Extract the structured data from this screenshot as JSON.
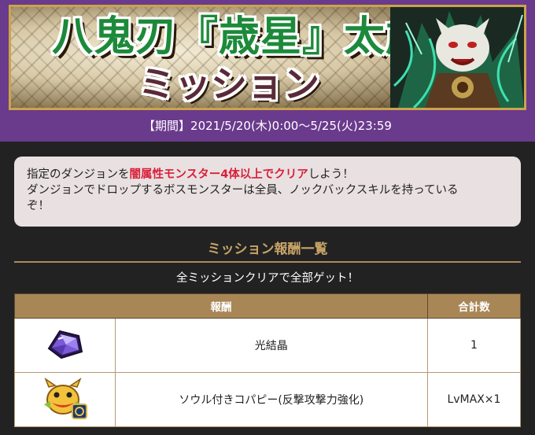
{
  "banner": {
    "title": "八鬼刃『歳星』太歳",
    "subtitle": "ミッション"
  },
  "period_text": "【期間】2021/5/20(木)0:00～5/25(火)23:59",
  "note": {
    "line1_pre": "指定のダンジョンを",
    "line1_highlight": "闇属性モンスター4体以上でクリア",
    "line1_post": "しよう！",
    "line2": "ダンジョンでドロップするボスモンスターは全員、ノックバックスキルを持っている",
    "line3": "ぞ！"
  },
  "rewards": {
    "section_title": "ミッション報酬一覧",
    "subtitle": "全ミッションクリアで全部ゲット！",
    "headers": {
      "reward": "報酬",
      "total": "合計数"
    },
    "rows": [
      {
        "icon": "purple-crystal-icon",
        "name": "光結晶",
        "total": "1"
      },
      {
        "icon": "soul-copy-monster-icon",
        "name": "ソウル付きコパピー(反撃攻撃力強化)",
        "total": "LvMAX×1"
      }
    ]
  },
  "colors": {
    "purple_bar": "#6a3a8c",
    "highlight_red": "#d8203a",
    "header_tan": "#a88656",
    "section_gold": "#c8a468"
  }
}
